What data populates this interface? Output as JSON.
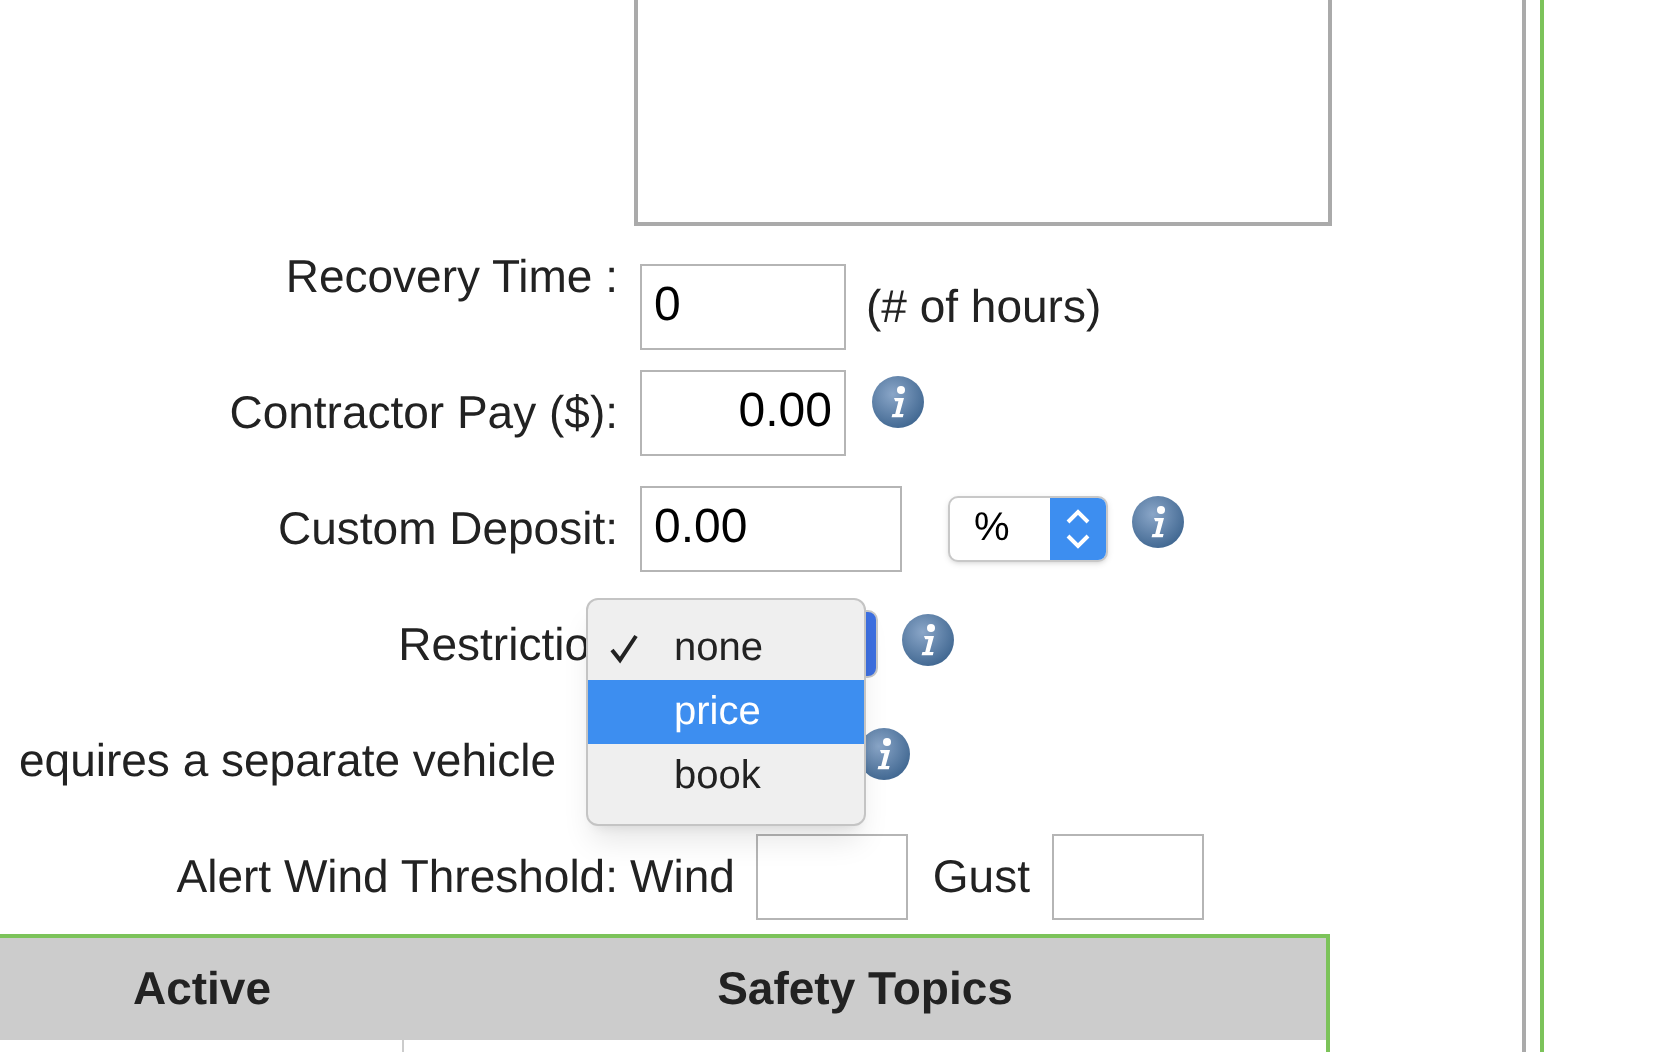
{
  "form": {
    "rows": [
      {
        "kind": "hours",
        "label": "Recovery Time :",
        "value": "0",
        "unit": "(# of hours)"
      },
      {
        "kind": "money",
        "label": "Contractor Pay ($):",
        "value": "0.00",
        "info": true
      },
      {
        "kind": "deposit",
        "label": "Custom Deposit:",
        "value": "0.00",
        "select": "%",
        "info": true
      },
      {
        "kind": "select",
        "label": "Restrictio",
        "info": true
      },
      {
        "kind": "hidden",
        "label": "equires a separate vehicle",
        "info": true
      },
      {
        "kind": "wind",
        "label": "Alert Wind Threshold:",
        "fields": [
          {
            "label": "Wind"
          },
          {
            "label": "Gust"
          }
        ]
      }
    ]
  },
  "dropdown": {
    "options": [
      {
        "label": "none",
        "checked": true,
        "selected": false
      },
      {
        "label": "price",
        "checked": false,
        "selected": true
      },
      {
        "label": "book",
        "checked": false,
        "selected": false
      }
    ]
  },
  "table": {
    "columns": [
      "Active",
      "Safety Topics"
    ]
  }
}
